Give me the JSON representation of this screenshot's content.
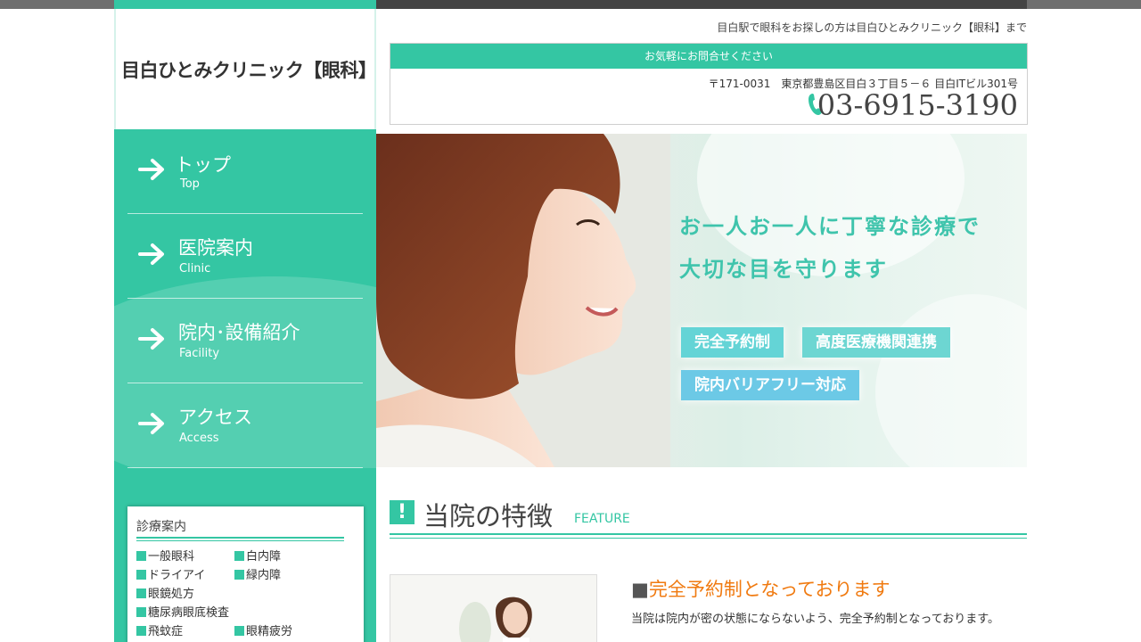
{
  "site": {
    "tagline": "目白駅で眼科をお探しの方は目白ひとみクリニック【眼科】まで",
    "logo": "目白ひとみクリニック【眼科】"
  },
  "contact": {
    "bar_label": "お気軽にお問合せください",
    "address": "〒171-0031　東京都豊島区目白３丁目５－６ 目白ITビル301号",
    "phone": "03-6915-3190"
  },
  "nav": {
    "items": [
      {
        "jp": "トップ",
        "en": "Top"
      },
      {
        "jp": "医院案内",
        "en": "Clinic"
      },
      {
        "jp": "院内･設備紹介",
        "en": "Facility"
      },
      {
        "jp": "アクセス",
        "en": "Access"
      }
    ]
  },
  "hero": {
    "line1": "お一人お一人に丁寧な診療で",
    "line2": "大切な目を守ります",
    "badges": [
      "完全予約制",
      "高度医療機関連携",
      "院内バリアフリー対応"
    ]
  },
  "services": {
    "title": "診療案内",
    "items": [
      "一般眼科",
      "白内障",
      "ドライアイ",
      "緑内障",
      "眼鏡処方",
      "糖尿病眼底検査",
      "飛蚊症",
      "眼精疲労"
    ]
  },
  "features": {
    "title": "当院の特徴",
    "title_en": "FEATURE",
    "icon": "!",
    "heading_mark": "■",
    "heading": "完全予約制となっております",
    "body": "当院は院内が密の状態にならないよう、完全予約制となっております。"
  },
  "colors": {
    "accent": "#34c6a3",
    "heading_orange": "#f07a10",
    "hero_text": "#3fc4ac"
  }
}
